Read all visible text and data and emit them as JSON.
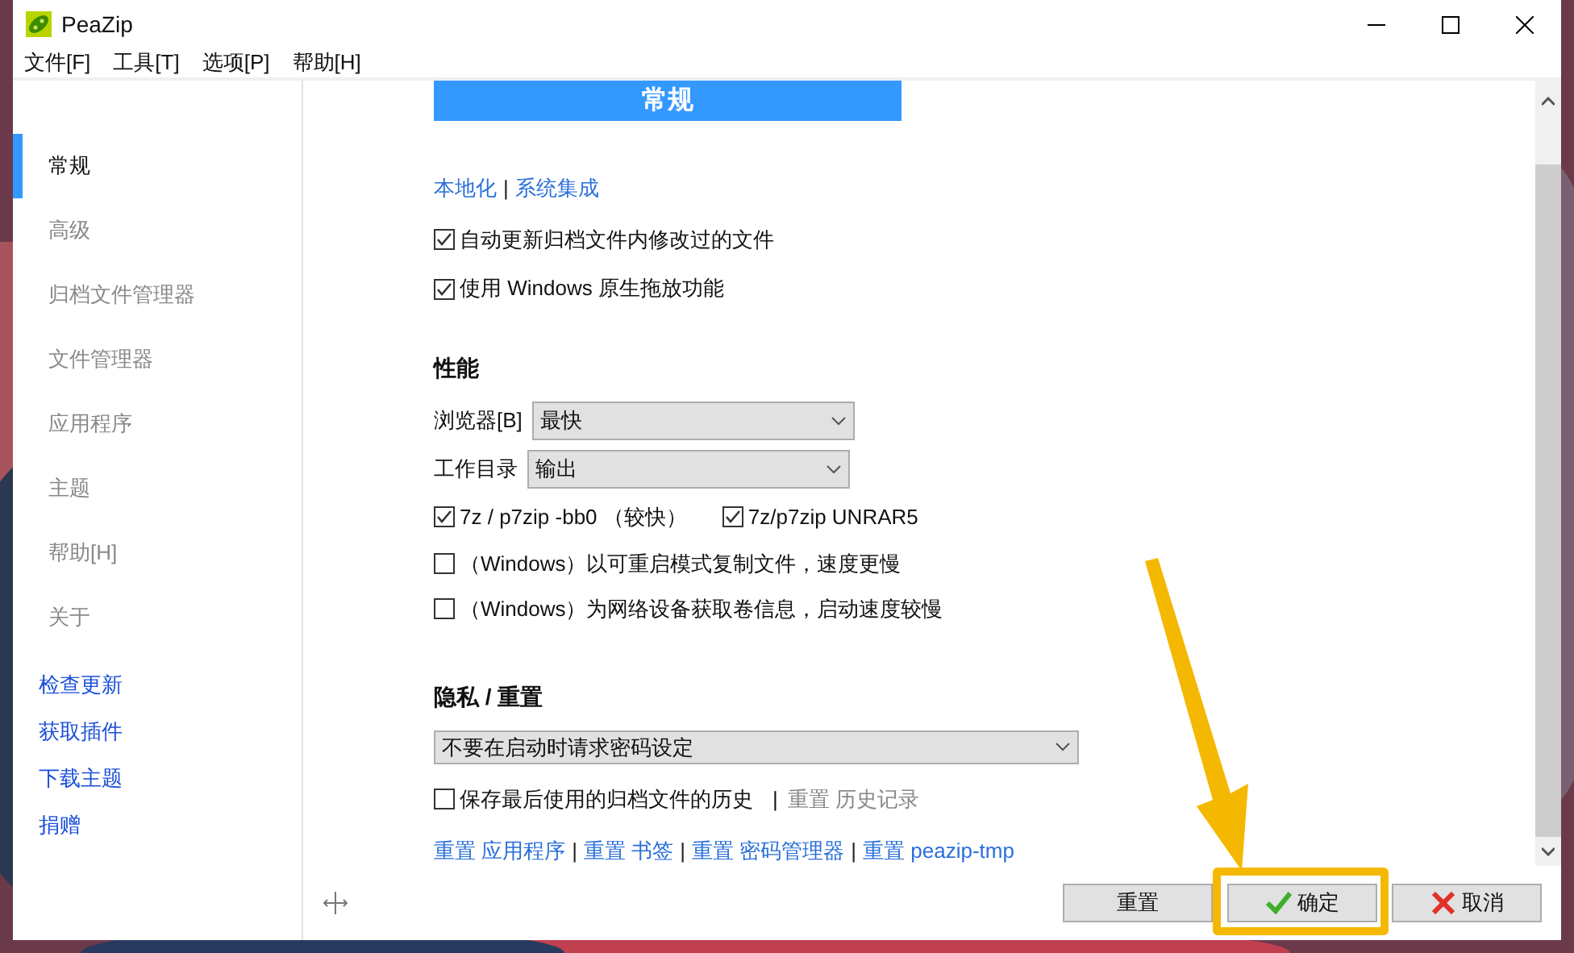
{
  "window": {
    "title": "PeaZip"
  },
  "menu": [
    {
      "label": "文件[F]"
    },
    {
      "label": "工具[T]"
    },
    {
      "label": "选项[P]"
    },
    {
      "label": "帮助[H]"
    }
  ],
  "sidebar": {
    "items": [
      {
        "label": "常规",
        "selected": true
      },
      {
        "label": "高级",
        "selected": false
      },
      {
        "label": "归档文件管理器",
        "selected": false
      },
      {
        "label": "文件管理器",
        "selected": false
      },
      {
        "label": "应用程序",
        "selected": false
      },
      {
        "label": "主题",
        "selected": false
      },
      {
        "label": "帮助[H]",
        "selected": false
      },
      {
        "label": "关于",
        "selected": false
      }
    ],
    "links": [
      {
        "label": "检查更新"
      },
      {
        "label": "获取插件"
      },
      {
        "label": "下载主题"
      },
      {
        "label": "捐赠"
      }
    ]
  },
  "header": "常规",
  "top_links": {
    "separator": "|",
    "items": [
      "本地化",
      "系统集成"
    ]
  },
  "general_options": [
    {
      "label": "自动更新归档文件内修改过的文件",
      "checked": true
    },
    {
      "label": "使用 Windows 原生拖放功能",
      "checked": true
    }
  ],
  "performance": {
    "title": "性能",
    "selects": [
      {
        "label": "浏览器[B]",
        "value": "最快"
      },
      {
        "label": "工作目录",
        "value": "输出"
      }
    ],
    "option_rows": [
      [
        {
          "label": "7z / p7zip -bb0 （较快）",
          "checked": true
        },
        {
          "label": "7z/p7zip UNRAR5",
          "checked": true
        }
      ],
      [
        {
          "label": "（Windows）以可重启模式复制文件，速度更慢",
          "checked": false
        }
      ],
      [
        {
          "label": "（Windows）为网络设备获取卷信息，启动速度较慢",
          "checked": false
        }
      ]
    ]
  },
  "privacy": {
    "title": "隐私 / 重置",
    "select": {
      "value": "不要在启动时请求密码设定"
    },
    "history": {
      "label": "保存最后使用的归档文件的历史",
      "checked": false,
      "separator": "|",
      "link": "重置 历史记录",
      "disabled": true
    },
    "reset_links": {
      "separator": "|",
      "items": [
        "重置 应用程序",
        "重置 书签",
        "重置 密码管理器",
        "重置 peazip-tmp"
      ]
    }
  },
  "buttons": [
    {
      "label": "重置",
      "kind": "plain"
    },
    {
      "label": "确定",
      "kind": "ok"
    },
    {
      "label": "取消",
      "kind": "cancel"
    }
  ]
}
